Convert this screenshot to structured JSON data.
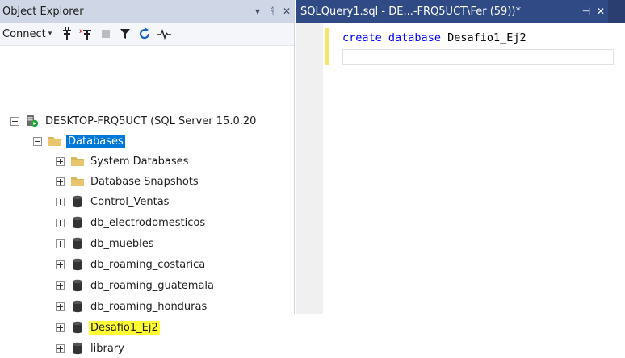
{
  "object_explorer": {
    "title": "Object Explorer",
    "header_buttons": [
      "▾",
      "ᛩ",
      "✕"
    ],
    "toolbar": {
      "connect_label": "Connect",
      "connect_caret": "▾"
    },
    "tree": [
      {
        "label": "DESKTOP-FRQ5UCT (SQL Server 15.0.20",
        "icon": "server-icon",
        "level": 0,
        "expanded": true
      },
      {
        "label": "Databases",
        "icon": "folder-icon",
        "level": 1,
        "expanded": true,
        "selected": true
      },
      {
        "label": "System Databases",
        "icon": "folder-icon",
        "level": 2,
        "expanded": false
      },
      {
        "label": "Database Snapshots",
        "icon": "folder-icon",
        "level": 2,
        "expanded": false
      },
      {
        "label": "Control_Ventas",
        "icon": "database-icon",
        "level": 2,
        "expanded": false
      },
      {
        "label": "db_electrodomesticos",
        "icon": "database-icon",
        "level": 2,
        "expanded": false
      },
      {
        "label": "db_muebles",
        "icon": "database-icon",
        "level": 2,
        "expanded": false
      },
      {
        "label": "db_roaming_costarica",
        "icon": "database-icon",
        "level": 2,
        "expanded": false
      },
      {
        "label": "db_roaming_guatemala",
        "icon": "database-icon",
        "level": 2,
        "expanded": false
      },
      {
        "label": "db_roaming_honduras",
        "icon": "database-icon",
        "level": 2,
        "expanded": false
      },
      {
        "label": "Desafio1_Ej2",
        "icon": "database-icon",
        "level": 2,
        "expanded": false,
        "highlighted": true
      },
      {
        "label": "library",
        "icon": "database-icon",
        "level": 2,
        "expanded": false
      }
    ]
  },
  "query_editor": {
    "tab_title": "SQLQuery1.sql - DE...-FRQ5UCT\\Fer (59))*",
    "tab_pin": "⊣",
    "tab_close": "✕",
    "code": {
      "keyword1": "create",
      "keyword2": "database",
      "identifier": "Desafio1_Ej2"
    }
  },
  "colors": {
    "selection": "#0078d7",
    "highlight": "#ffff33",
    "tab_active": "#2f4a85",
    "tab_bar": "#3d5a99",
    "keyword": "#0000ff",
    "change_bar": "#f5e469"
  }
}
